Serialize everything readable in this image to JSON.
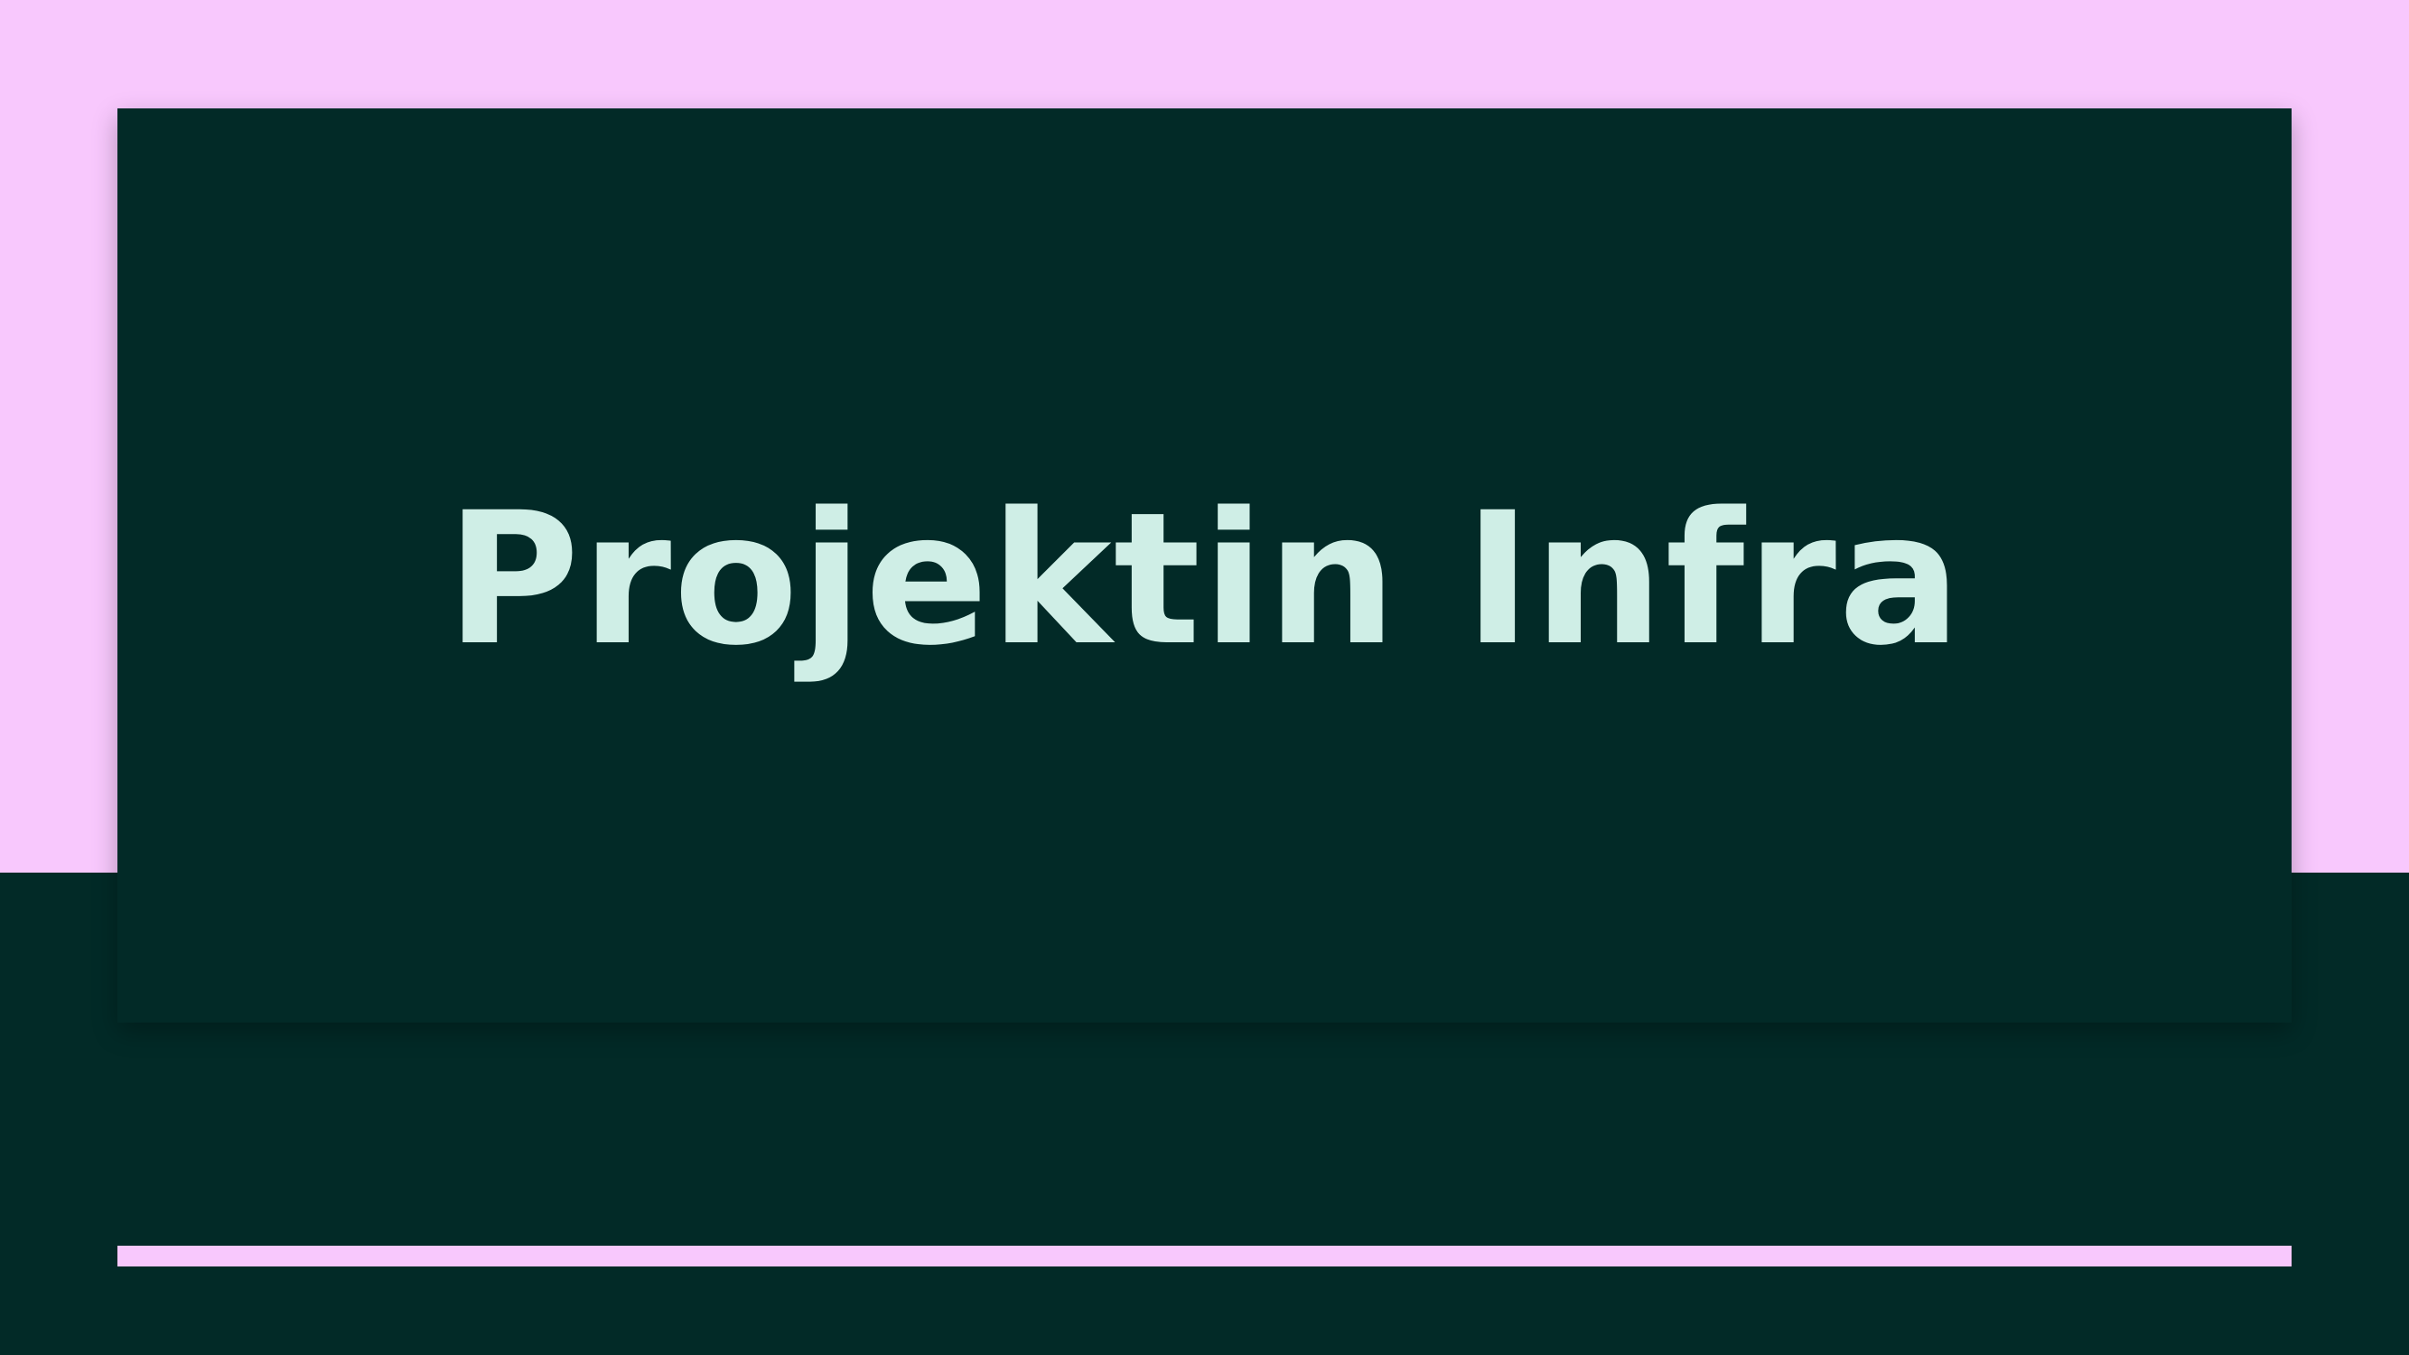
{
  "slide": {
    "title": "Projektin Infra"
  },
  "colors": {
    "pink": "#f8c8fd",
    "dark_teal": "#022a27",
    "mint_text": "#cfeee6"
  }
}
